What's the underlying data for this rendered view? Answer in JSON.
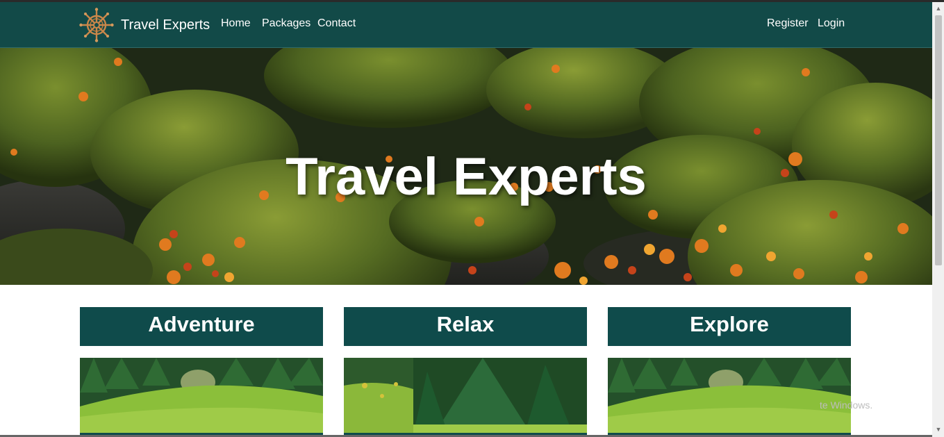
{
  "window": {
    "watermark": "te Windows."
  },
  "navbar": {
    "brand": {
      "name": "Travel Experts",
      "icon": "ship-wheel-icon"
    },
    "left_links": [
      "Home",
      "Packages",
      "Contact"
    ],
    "right_links": [
      "Register",
      "Login"
    ]
  },
  "hero": {
    "title": "Travel Experts",
    "image": "mossy-rocks-autumn-leaves"
  },
  "cards": [
    {
      "title": "Adventure",
      "image": "grassy-hill-forest"
    },
    {
      "title": "Relax",
      "image": "meadow-evergreen-tree"
    },
    {
      "title": "Explore",
      "image": "grassy-hill-forest"
    }
  ],
  "colors": {
    "navbar": "#124a48",
    "card_header": "#0f4b4b",
    "text_light": "#ffffff"
  }
}
